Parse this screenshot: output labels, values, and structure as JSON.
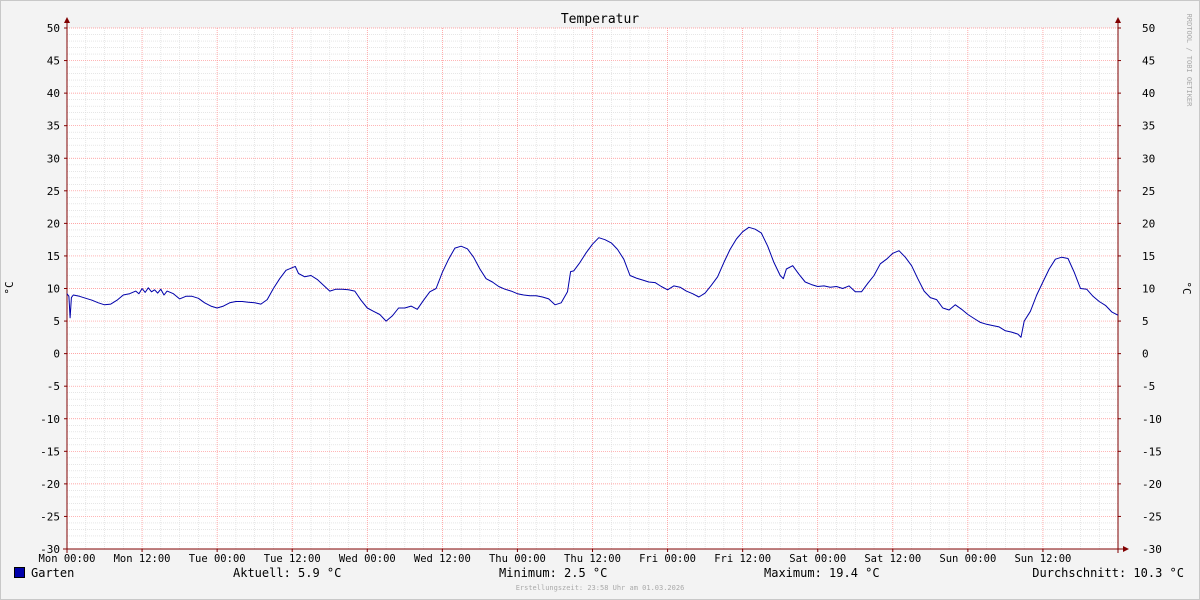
{
  "chart_data": {
    "type": "line",
    "title": "Temperatur",
    "ylabel": "°C",
    "ylim": [
      -30,
      50
    ],
    "y_ticks": [
      50,
      45,
      40,
      35,
      30,
      25,
      20,
      15,
      10,
      5,
      0,
      -5,
      -10,
      -15,
      -20,
      -25,
      -30
    ],
    "x_range_hours": [
      0,
      168
    ],
    "x_ticks": [
      {
        "h": 0,
        "label": "Mon 00:00"
      },
      {
        "h": 12,
        "label": "Mon 12:00"
      },
      {
        "h": 24,
        "label": "Tue 00:00"
      },
      {
        "h": 36,
        "label": "Tue 12:00"
      },
      {
        "h": 48,
        "label": "Wed 00:00"
      },
      {
        "h": 60,
        "label": "Wed 12:00"
      },
      {
        "h": 72,
        "label": "Thu 00:00"
      },
      {
        "h": 84,
        "label": "Thu 12:00"
      },
      {
        "h": 96,
        "label": "Fri 00:00"
      },
      {
        "h": 108,
        "label": "Fri 12:00"
      },
      {
        "h": 120,
        "label": "Sat 00:00"
      },
      {
        "h": 132,
        "label": "Sat 12:00"
      },
      {
        "h": 144,
        "label": "Sun 00:00"
      },
      {
        "h": 156,
        "label": "Sun 12:00"
      }
    ],
    "grid": true,
    "series": [
      {
        "name": "Garten",
        "color": "#0000aa",
        "points": [
          [
            0,
            9.2
          ],
          [
            0.3,
            8.8
          ],
          [
            0.5,
            5.5
          ],
          [
            0.7,
            8.6
          ],
          [
            1,
            9
          ],
          [
            2,
            8.8
          ],
          [
            3,
            8.5
          ],
          [
            4,
            8.2
          ],
          [
            5,
            7.8
          ],
          [
            6,
            7.5
          ],
          [
            7,
            7.6
          ],
          [
            8,
            8.2
          ],
          [
            9,
            9
          ],
          [
            10,
            9.2
          ],
          [
            11,
            9.6
          ],
          [
            11.5,
            9.2
          ],
          [
            12,
            10
          ],
          [
            12.5,
            9.4
          ],
          [
            13,
            10.1
          ],
          [
            13.5,
            9.5
          ],
          [
            14,
            9.8
          ],
          [
            14.5,
            9.3
          ],
          [
            15,
            9.9
          ],
          [
            15.5,
            9
          ],
          [
            16,
            9.6
          ],
          [
            17,
            9.2
          ],
          [
            18,
            8.4
          ],
          [
            19,
            8.8
          ],
          [
            20,
            8.8
          ],
          [
            21,
            8.5
          ],
          [
            22,
            7.8
          ],
          [
            23,
            7.3
          ],
          [
            24,
            7
          ],
          [
            25,
            7.3
          ],
          [
            26,
            7.8
          ],
          [
            27,
            8
          ],
          [
            28,
            8
          ],
          [
            29,
            7.9
          ],
          [
            30,
            7.8
          ],
          [
            31,
            7.6
          ],
          [
            32,
            8.3
          ],
          [
            33,
            10
          ],
          [
            34,
            11.5
          ],
          [
            35,
            12.8
          ],
          [
            36,
            13.2
          ],
          [
            36.5,
            13.4
          ],
          [
            37,
            12.3
          ],
          [
            38,
            11.8
          ],
          [
            39,
            12
          ],
          [
            40,
            11.4
          ],
          [
            41,
            10.5
          ],
          [
            42,
            9.6
          ],
          [
            43,
            9.9
          ],
          [
            44,
            9.9
          ],
          [
            45,
            9.8
          ],
          [
            46,
            9.6
          ],
          [
            47,
            8.2
          ],
          [
            48,
            7
          ],
          [
            49,
            6.5
          ],
          [
            50,
            6
          ],
          [
            51,
            5
          ],
          [
            52,
            5.8
          ],
          [
            53,
            7
          ],
          [
            54,
            7
          ],
          [
            55,
            7.3
          ],
          [
            56,
            6.8
          ],
          [
            57,
            8.2
          ],
          [
            58,
            9.5
          ],
          [
            59,
            10
          ],
          [
            60,
            12.5
          ],
          [
            61,
            14.5
          ],
          [
            62,
            16.2
          ],
          [
            63,
            16.5
          ],
          [
            64,
            16.1
          ],
          [
            65,
            14.8
          ],
          [
            66,
            13
          ],
          [
            67,
            11.5
          ],
          [
            68,
            11
          ],
          [
            69,
            10.3
          ],
          [
            70,
            9.9
          ],
          [
            71,
            9.6
          ],
          [
            72,
            9.2
          ],
          [
            73,
            9
          ],
          [
            74,
            8.9
          ],
          [
            75,
            8.9
          ],
          [
            76,
            8.7
          ],
          [
            77,
            8.4
          ],
          [
            78,
            7.5
          ],
          [
            79,
            7.8
          ],
          [
            80,
            9.5
          ],
          [
            80.5,
            12.6
          ],
          [
            81,
            12.7
          ],
          [
            82,
            14
          ],
          [
            83,
            15.5
          ],
          [
            84,
            16.8
          ],
          [
            85,
            17.8
          ],
          [
            86,
            17.5
          ],
          [
            87,
            17
          ],
          [
            88,
            16
          ],
          [
            89,
            14.5
          ],
          [
            90,
            12
          ],
          [
            91,
            11.6
          ],
          [
            92,
            11.3
          ],
          [
            93,
            11
          ],
          [
            94,
            10.9
          ],
          [
            95,
            10.3
          ],
          [
            96,
            9.8
          ],
          [
            97,
            10.4
          ],
          [
            98,
            10.2
          ],
          [
            99,
            9.6
          ],
          [
            100,
            9.2
          ],
          [
            101,
            8.7
          ],
          [
            102,
            9.3
          ],
          [
            103,
            10.5
          ],
          [
            104,
            11.8
          ],
          [
            105,
            14
          ],
          [
            106,
            16
          ],
          [
            107,
            17.6
          ],
          [
            108,
            18.7
          ],
          [
            109,
            19.4
          ],
          [
            110,
            19.1
          ],
          [
            111,
            18.5
          ],
          [
            112,
            16.5
          ],
          [
            113,
            14
          ],
          [
            114,
            12
          ],
          [
            114.5,
            11.5
          ],
          [
            115,
            13
          ],
          [
            116,
            13.5
          ],
          [
            117,
            12.2
          ],
          [
            118,
            11
          ],
          [
            119,
            10.6
          ],
          [
            120,
            10.3
          ],
          [
            121,
            10.4
          ],
          [
            122,
            10.2
          ],
          [
            123,
            10.3
          ],
          [
            124,
            10
          ],
          [
            125,
            10.4
          ],
          [
            126,
            9.5
          ],
          [
            127,
            9.5
          ],
          [
            128,
            10.8
          ],
          [
            129,
            12
          ],
          [
            130,
            13.8
          ],
          [
            131,
            14.5
          ],
          [
            132,
            15.4
          ],
          [
            133,
            15.8
          ],
          [
            134,
            14.8
          ],
          [
            135,
            13.5
          ],
          [
            136,
            11.5
          ],
          [
            137,
            9.6
          ],
          [
            138,
            8.6
          ],
          [
            139,
            8.3
          ],
          [
            140,
            7
          ],
          [
            141,
            6.7
          ],
          [
            142,
            7.5
          ],
          [
            143,
            6.8
          ],
          [
            144,
            6
          ],
          [
            145,
            5.4
          ],
          [
            146,
            4.8
          ],
          [
            147,
            4.5
          ],
          [
            148,
            4.3
          ],
          [
            149,
            4.1
          ],
          [
            150,
            3.5
          ],
          [
            151,
            3.3
          ],
          [
            152,
            3
          ],
          [
            152.5,
            2.5
          ],
          [
            153,
            5
          ],
          [
            154,
            6.5
          ],
          [
            155,
            9
          ],
          [
            156,
            11
          ],
          [
            157,
            13
          ],
          [
            158,
            14.5
          ],
          [
            159,
            14.8
          ],
          [
            160,
            14.6
          ],
          [
            161,
            12.5
          ],
          [
            162,
            10
          ],
          [
            163,
            9.9
          ],
          [
            164,
            8.8
          ],
          [
            165,
            8
          ],
          [
            166,
            7.4
          ],
          [
            167,
            6.4
          ],
          [
            168,
            5.9
          ]
        ]
      }
    ]
  },
  "side_text": "RRDTOOL / TOBI OETIKER",
  "legend": {
    "series_name": "Garten",
    "current": "Aktuell: 5.9 °C",
    "minimum": "Minimum: 2.5 °C",
    "maximum": "Maximum: 19.4 °C",
    "average": "Durchschnitt: 10.3 °C"
  },
  "footer": "Erstellungszeit: 23:58 Uhr am 01.03.2026",
  "colors": {
    "line": "#0000aa",
    "major_grid": "#ff8a8a",
    "minor_grid": "#d8d8d8",
    "axis": "#800000",
    "plot_bg": "#ffffff",
    "canvas_bg": "#f3f3f3"
  }
}
